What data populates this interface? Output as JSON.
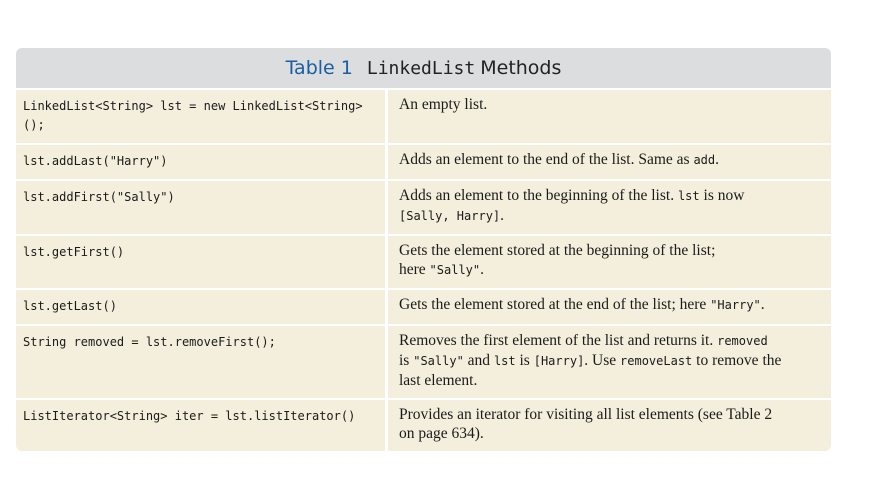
{
  "caption": {
    "number": "Table 1",
    "code": "LinkedList",
    "word": "Methods"
  },
  "rows": [
    {
      "code": "LinkedList<String> lst = new LinkedList<String>();",
      "desc": [
        {
          "t": "An empty list."
        }
      ]
    },
    {
      "code": "lst.addLast(\"Harry\")",
      "desc": [
        {
          "t": "Adds an element to the end of the list. Same as "
        },
        {
          "t": "add",
          "mono": true
        },
        {
          "t": "."
        }
      ]
    },
    {
      "code": "lst.addFirst(\"Sally\")",
      "desc": [
        {
          "t": "Adds an element to the beginning of the list. "
        },
        {
          "t": "lst",
          "mono": true
        },
        {
          "t": " is now "
        },
        {
          "br": true
        },
        {
          "t": "[Sally, Harry]",
          "mono": true
        },
        {
          "t": "."
        }
      ]
    },
    {
      "code": "lst.getFirst()",
      "desc": [
        {
          "t": "Gets the element stored at the beginning of the list;"
        },
        {
          "br": true
        },
        {
          "t": "here "
        },
        {
          "t": "\"Sally\"",
          "mono": true
        },
        {
          "t": "."
        }
      ]
    },
    {
      "code": "lst.getLast()",
      "desc": [
        {
          "t": "Gets the element stored at the end of the list; here "
        },
        {
          "t": "\"Harry\"",
          "mono": true
        },
        {
          "t": "."
        }
      ]
    },
    {
      "code": "String removed = lst.removeFirst();",
      "desc": [
        {
          "t": "Removes the first element of the list and returns it. "
        },
        {
          "t": "removed",
          "mono": true
        },
        {
          "br": true
        },
        {
          "t": "is "
        },
        {
          "t": "\"Sally\"",
          "mono": true
        },
        {
          "t": " and "
        },
        {
          "t": "lst",
          "mono": true
        },
        {
          "t": " is "
        },
        {
          "t": "[Harry]",
          "mono": true
        },
        {
          "t": ". Use "
        },
        {
          "t": "removeLast",
          "mono": true
        },
        {
          "t": " to remove the"
        },
        {
          "br": true
        },
        {
          "t": "last element."
        }
      ]
    },
    {
      "code": "ListIterator<String> iter = lst.listIterator()",
      "desc": [
        {
          "t": "Provides an iterator for visiting all list elements (see Table 2"
        },
        {
          "br": true
        },
        {
          "t": "on page 634)."
        }
      ]
    }
  ]
}
